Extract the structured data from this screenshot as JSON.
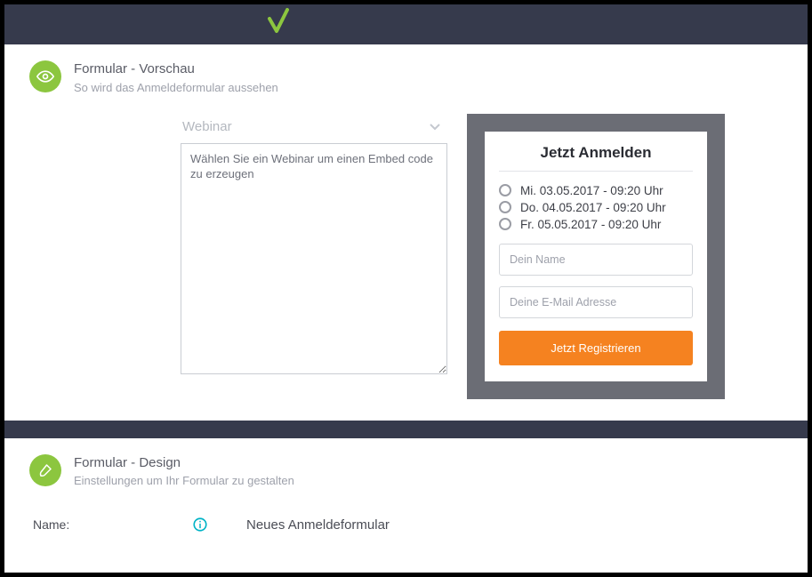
{
  "preview": {
    "title": "Formular - Vorschau",
    "subtitle": "So wird das Anmeldeformular aussehen",
    "dropdown_label": "Webinar",
    "embed_text": "Wählen Sie ein Webinar um einen Embed code zu erzeugen",
    "form": {
      "title": "Jetzt Anmelden",
      "dates": [
        "Mi. 03.05.2017 - 09:20 Uhr",
        "Do. 04.05.2017 - 09:20 Uhr",
        "Fr. 05.05.2017 - 09:20 Uhr"
      ],
      "name_placeholder": "Dein Name",
      "email_placeholder": "Deine E-Mail Adresse",
      "submit_label": "Jetzt Registrieren"
    }
  },
  "design": {
    "title": "Formular - Design",
    "subtitle": "Einstellungen um Ihr Formular zu gestalten",
    "name_label": "Name:",
    "name_value": "Neues Anmeldeformular"
  }
}
